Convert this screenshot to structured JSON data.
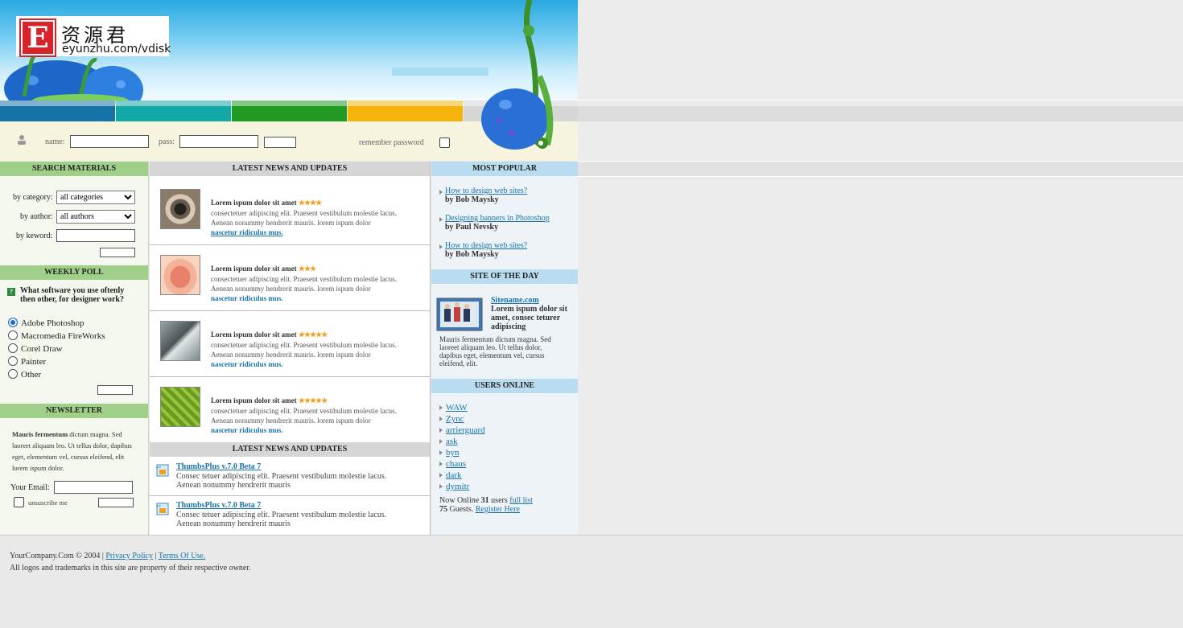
{
  "logo": {
    "mark": "E",
    "cn_text": "资源君",
    "url": "eyunzhu.com/vdisk"
  },
  "colors": {
    "stripe1": "#1474a8",
    "stripe2": "#13a8a8",
    "stripe3": "#209a20",
    "stripe4": "#f5b40a",
    "stripe5": "#d6d6d6"
  },
  "login": {
    "name_label": "name:",
    "pass_label": "pass:",
    "remember_label": "remember password"
  },
  "search": {
    "title": "SEARCH MATERIALS",
    "category_label": "by category:",
    "category_value": "all categories",
    "author_label": "by author:",
    "author_value": "all authors",
    "keyword_label": "by keword:"
  },
  "poll": {
    "title": "WEEKLY POLL",
    "question": "What software you use oftenly then other, for designer work?",
    "options": [
      "Adobe Photoshop",
      "Macromedia FireWorks",
      "Corel Draw",
      "Painter",
      "Other"
    ]
  },
  "newsletter": {
    "title": "NEWSLETTER",
    "text_bold": "Mauris fermentum",
    "text": " dictum magna. Sed laoreet aliquam leo. Ut tellus dolor, dapibus eget, elementum vel, cursus eleifend, elit lorem ispum dolor.",
    "email_label": "Your Email:",
    "unsubscribe_label": "unsuscribe me"
  },
  "news": {
    "title": "LATEST NEWS AND UPDATES",
    "items": [
      {
        "title": "Lorem ispum dolor sit amet",
        "stars": "★★★★",
        "text": "consectetuer adipiscing elit. Praesent vestibulum molestie lacus. Aenean nonummy hendrerit mauris. lorem ispum dolor",
        "more": "nascetur ridiculus mus.",
        "thumb": "eye-icon"
      },
      {
        "title": "Lorem ispum dolor sit amet",
        "stars": "★★★",
        "text": "consectetuer adipiscing elit. Praesent vestibulum molestie lacus. Aenean nonummy hendrerit mauris. lorem ispum dolor",
        "more": "nascetur ridiculus mus.",
        "thumb": "lips-icon"
      },
      {
        "title": "Lorem ispum dolor sit amet",
        "stars": "★★★★★",
        "text": "consectetuer adipiscing elit. Praesent vestibulum molestie lacus. Aenean nonummy hendrerit mauris. lorem ispum dolor",
        "more": "nascetur ridiculus mus.",
        "thumb": "feather-icon"
      },
      {
        "title": "Lorem ispum dolor sit amet",
        "stars": "★★★★★",
        "text": "consectetuer adipiscing elit. Praesent vestibulum molestie lacus. Aenean nonummy hendrerit mauris. lorem ispum dolor",
        "more": "nascetur ridiculus mus.",
        "thumb": "leaf-icon"
      }
    ]
  },
  "updates": {
    "title": "LATEST NEWS AND UPDATES",
    "items": [
      {
        "title": "ThumbsPlus v.7.0 Beta 7",
        "line1": "Consec tetuer adipiscing elit. Praesent vestibulum molestie lacus.",
        "line2": "Aenean nonummy hendrerit mauris"
      },
      {
        "title": "ThumbsPlus v.7.0 Beta 7",
        "line1": "Consec tetuer adipiscing elit. Praesent vestibulum molestie lacus.",
        "line2": "Aenean nonummy hendrerit mauris"
      }
    ]
  },
  "popular": {
    "title": "MOST POPULAR",
    "items": [
      {
        "link": "How to design web sites?",
        "author": "by Bob Maysky"
      },
      {
        "link": "Designing banners in Photoshop",
        "author": "by Paul Nevsky"
      },
      {
        "link": "How to design web sites?",
        "author": "by Bob Maysky"
      }
    ]
  },
  "site_of_day": {
    "title": "SITE OF THE DAY",
    "name": "Sitename.com",
    "tagline": "Lorem ispum dolor sit amet, consec teturer adipiscing",
    "text": "Mauris fermentum dictum magna. Sed laoreet aliquam leo. Ut tellus dolor, dapibus eget, elementum vel, cursus eleifend, elit."
  },
  "users": {
    "title": "USERS ONLINE",
    "list": [
      "WAW",
      "Zync",
      "arrierguard",
      "ask",
      "byn",
      "chaus",
      "dark",
      "dymitr"
    ],
    "now_online_prefix": "Now Online",
    "count": "31",
    "users_word": "users",
    "full_list": "full list",
    "guests": "75",
    "guests_word": "Guests.",
    "register": "Register Here"
  },
  "footer": {
    "copyright": "YourCompany.Com © 2004 |",
    "privacy": "Privacy Policy",
    "sep": "|",
    "terms": "Terms Of Use.",
    "line2": "All logos and trademarks in this site are property of their respective owner."
  }
}
